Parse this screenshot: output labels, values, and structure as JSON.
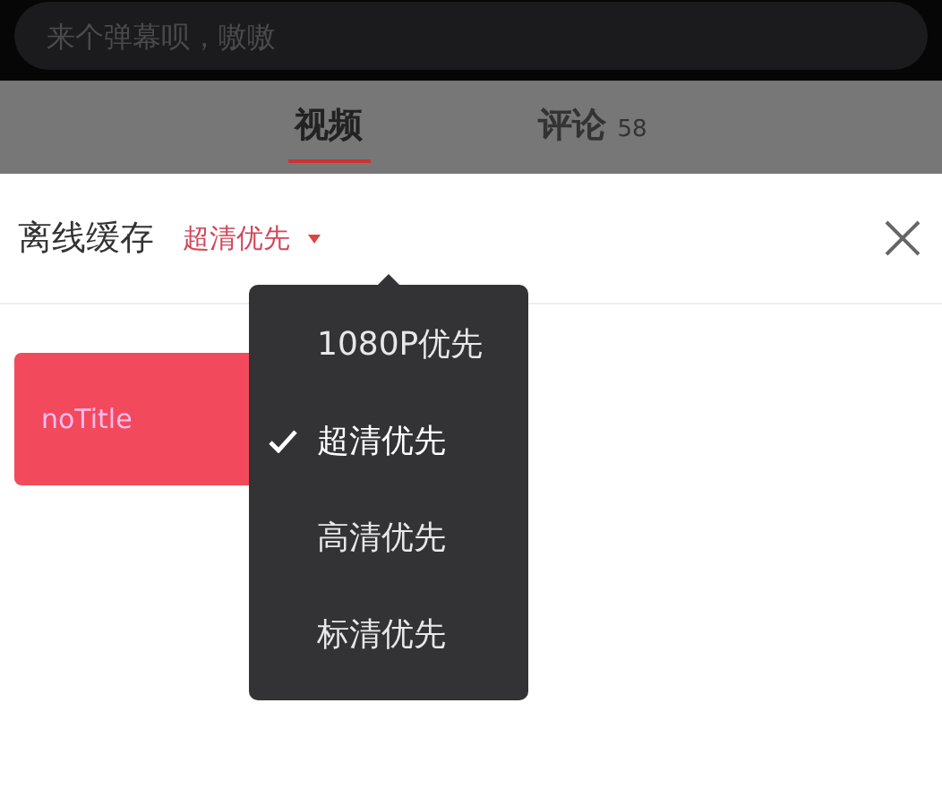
{
  "comment_bar": {
    "placeholder": "来个弹幕呗，嗷嗷"
  },
  "tabs": [
    {
      "label": "视频",
      "selected": true
    },
    {
      "label": "评论",
      "count": "58",
      "selected": false
    }
  ],
  "panel": {
    "title": "离线缓存",
    "quality": "超清优先"
  },
  "videos": [
    {
      "title": "noTitle"
    }
  ],
  "quality_menu": [
    {
      "label": "1080P优先",
      "selected": false
    },
    {
      "label": "超清优先",
      "selected": true
    },
    {
      "label": "高清优先",
      "selected": false
    },
    {
      "label": "标清优先",
      "selected": false
    }
  ]
}
